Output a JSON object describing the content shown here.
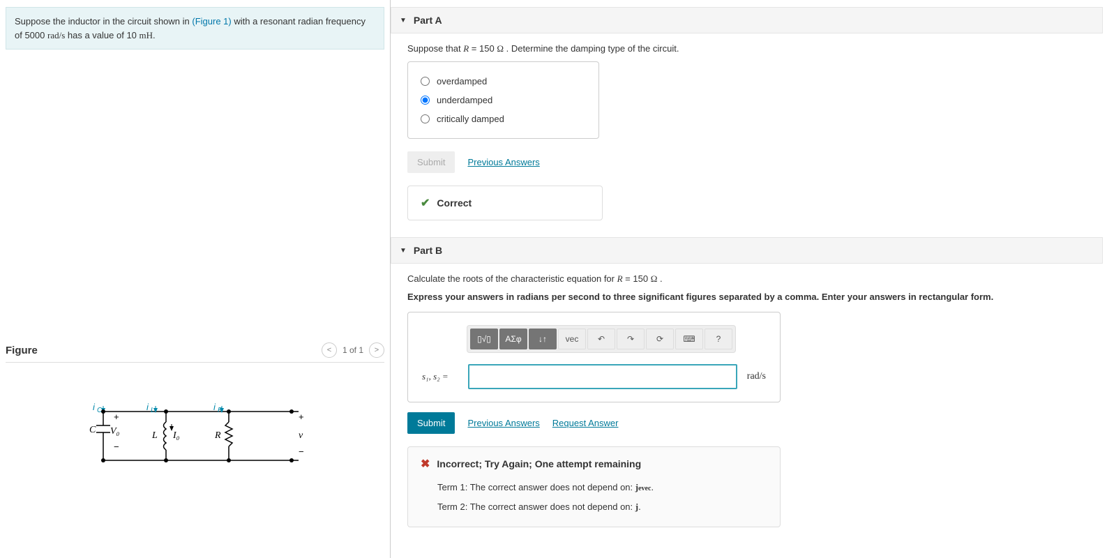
{
  "problem": {
    "text_prefix": "Suppose the inductor in the circuit shown in ",
    "figure_link": "(Figure 1)",
    "text_mid": " with a resonant radian frequency of 5000 ",
    "freq_unit": "rad/s",
    "text_mid2": " has a value of 10 ",
    "ind_unit": "mH",
    "text_end": "."
  },
  "figure": {
    "title": "Figure",
    "pager": "1 of 1"
  },
  "part_a": {
    "title": "Part A",
    "prompt_prefix": "Suppose that ",
    "prompt_var": "R",
    "prompt_mid": " = 150 ",
    "prompt_unit": "Ω",
    "prompt_end": " . Determine the damping type of the circuit.",
    "options": {
      "opt1": "overdamped",
      "opt2": "underdamped",
      "opt3": "critically damped"
    },
    "submit": "Submit",
    "prev_answers": "Previous Answers",
    "feedback": "Correct"
  },
  "part_b": {
    "title": "Part B",
    "prompt_prefix": "Calculate the roots of the characteristic equation for ",
    "prompt_var": "R",
    "prompt_mid": " = 150 ",
    "prompt_unit": "Ω",
    "prompt_end": " .",
    "instruction": "Express your answers in radians per second to three significant figures separated by a comma. Enter your answers in rectangular form.",
    "answer_label": "s₁, s₂ =",
    "answer_value": "",
    "answer_unit": "rad/s",
    "submit": "Submit",
    "prev_answers": "Previous Answers",
    "request_answer": "Request Answer",
    "incorrect_title": "Incorrect; Try Again; One attempt remaining",
    "term1_prefix": "Term 1: The correct answer does not depend on: ",
    "term1_var": "jevec",
    "term1_end": ".",
    "term2_prefix": "Term 2: The correct answer does not depend on: ",
    "term2_var": "j",
    "term2_end": "."
  },
  "toolbar": {
    "t1": "▯√▯",
    "t2": "ΑΣφ",
    "t3": "↓↑",
    "t4": "vec",
    "t5": "↶",
    "t6": "↷",
    "t7": "⟳",
    "t8": "⌨",
    "t9": "?"
  }
}
